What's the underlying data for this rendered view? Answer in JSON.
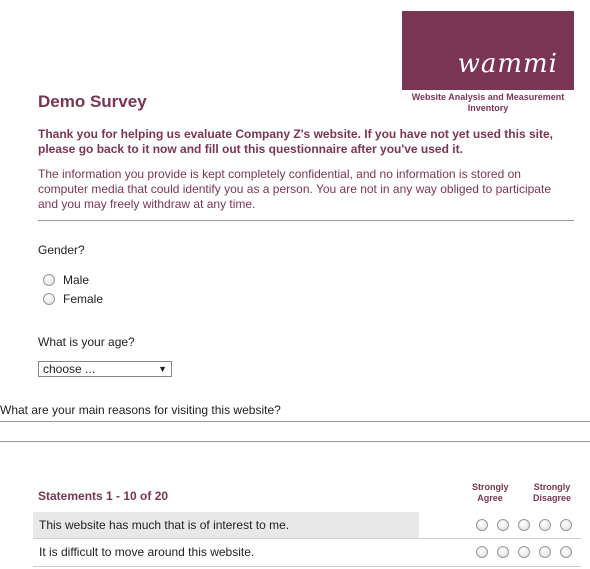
{
  "logo": {
    "text": "wammi",
    "caption": "Website Analysis and Measurement Inventory",
    "bg_color": "#7a3555"
  },
  "survey": {
    "title": "Demo Survey",
    "intro_bold": "Thank you for helping us evaluate Company Z's website. If you have not yet used this site, please go back to it now and fill out this questionnaire after you've used it.",
    "intro": "The information you provide is kept completely confidential, and no information is stored on computer media that could identify you as a person. You are not in any way obliged to participate and you may freely withdraw at any time."
  },
  "gender": {
    "question": "Gender?",
    "options": [
      "Male",
      "Female"
    ]
  },
  "age": {
    "question": "What is your age?",
    "selected": "choose ..."
  },
  "reasons": {
    "question": "What are your main reasons for visiting this website?"
  },
  "statements": {
    "header": "Statements 1 - 10 of 20",
    "scale_left": "Strongly Agree",
    "scale_right": "Strongly Disagree",
    "items": [
      "This website has much that is of interest to me.",
      "It is difficult to move around this website."
    ]
  }
}
